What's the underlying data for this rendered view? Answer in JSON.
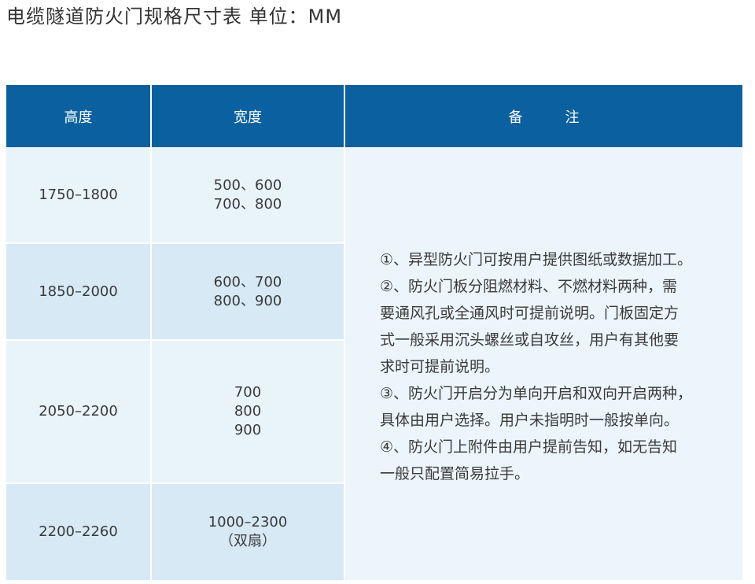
{
  "title": "电缆隧道防火门规格尺寸表 单位：MM",
  "table": {
    "headers": [
      "高度",
      "宽度",
      "备　注"
    ],
    "rows": [
      {
        "height": "1750–1800",
        "width": [
          "500、600",
          "700、800"
        ]
      },
      {
        "height": "1850–2000",
        "width": [
          "600、700",
          "800、900"
        ]
      },
      {
        "height": "2050–2200",
        "width": [
          "700",
          "800",
          "900"
        ]
      },
      {
        "height": "2200–2260",
        "width": [
          "1000–2300",
          "（双扇）"
        ]
      }
    ],
    "remarks": [
      "①、异型防火门可按用户提供图纸或数据加工。",
      "②、防火门板分阻燃材料、不燃材料两种，需",
      "要通风孔或全通风时可提前说明。门板固定方",
      "式一般采用沉头螺丝或自攻丝，用户有其他要",
      "求时可提前说明。",
      "③、防火门开启分为单向开启和双向开启两种，",
      "具体由用户选择。用户未指明时一般按单向。",
      "④、防火门上附件由用户提前告知，如无告知",
      "一般只配置简易拉手。"
    ]
  },
  "colors": {
    "header_bg": "#0b61a0",
    "row_light": "#e9f3fa",
    "row_dark": "#d6e9f5"
  }
}
